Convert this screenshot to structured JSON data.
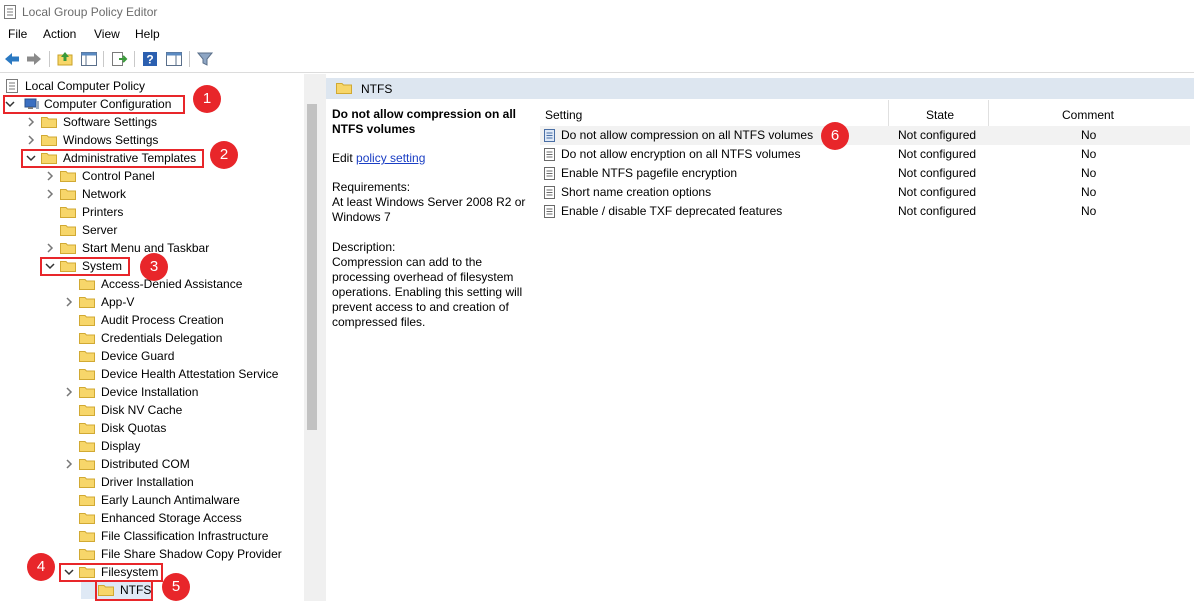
{
  "window": {
    "title": "Local Group Policy Editor"
  },
  "menu": [
    "File",
    "Action",
    "View",
    "Help"
  ],
  "toolbar": {
    "buttons": [
      "back-icon",
      "forward-icon",
      "up-folder-icon",
      "show-hide-tree-icon",
      "export-list-icon",
      "help-icon",
      "properties-pane-icon",
      "filter-icon"
    ]
  },
  "tree": {
    "root": "Local Computer Policy",
    "computer_configuration": "Computer Configuration",
    "software_settings": "Software Settings",
    "windows_settings": "Windows Settings",
    "administrative_templates": "Administrative Templates",
    "control_panel": "Control Panel",
    "network": "Network",
    "printers": "Printers",
    "server": "Server",
    "start_menu": "Start Menu and Taskbar",
    "system": "System",
    "system_children": [
      "Access-Denied Assistance",
      "App-V",
      "Audit Process Creation",
      "Credentials Delegation",
      "Device Guard",
      "Device Health Attestation Service",
      "Device Installation",
      "Disk NV Cache",
      "Disk Quotas",
      "Display",
      "Distributed COM",
      "Driver Installation",
      "Early Launch Antimalware",
      "Enhanced Storage Access",
      "File Classification Infrastructure",
      "File Share Shadow Copy Provider"
    ],
    "filesystem": "Filesystem",
    "ntfs": "NTFS"
  },
  "right": {
    "header": "NTFS",
    "description": {
      "title": "Do not allow compression on all NTFS volumes",
      "edit_prefix": "Edit",
      "edit_link": "policy setting",
      "requirements_label": "Requirements:",
      "requirements": "At least Windows Server 2008 R2 or Windows 7",
      "description_label": "Description:",
      "description": "Compression can add to the processing overhead of filesystem operations.  Enabling this setting will prevent access to and creation of compressed files."
    },
    "columns": {
      "setting": "Setting",
      "state": "State",
      "comment": "Comment"
    },
    "settings": [
      {
        "name": "Do not allow compression on all NTFS volumes",
        "state": "Not configured",
        "comment": "No"
      },
      {
        "name": "Do not allow encryption on all NTFS volumes",
        "state": "Not configured",
        "comment": "No"
      },
      {
        "name": "Enable NTFS pagefile encryption",
        "state": "Not configured",
        "comment": "No"
      },
      {
        "name": "Short name creation options",
        "state": "Not configured",
        "comment": "No"
      },
      {
        "name": "Enable / disable TXF deprecated features",
        "state": "Not configured",
        "comment": "No"
      }
    ]
  },
  "annotations": [
    "1",
    "2",
    "3",
    "4",
    "5",
    "6"
  ],
  "colors": {
    "highlight": "#e8262a",
    "header_bg": "#dde6f0",
    "folder": "#f7d66a",
    "link": "#1a3ec4"
  }
}
